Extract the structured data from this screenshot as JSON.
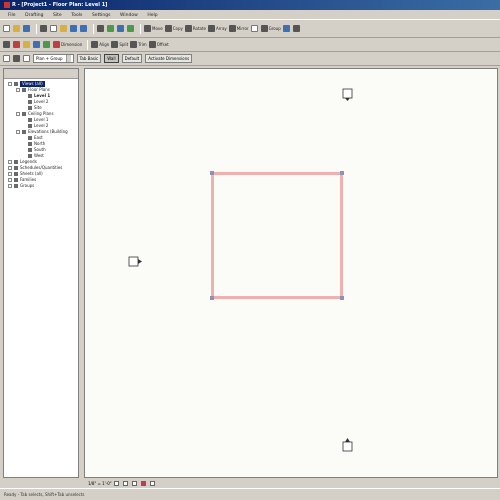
{
  "window": {
    "title": "R - [Project1 - Floor Plan: Level 1]"
  },
  "menu": [
    "File",
    "Drafting",
    "Site",
    "Tools",
    "Settings",
    "Window",
    "Help"
  ],
  "toolbar1": {
    "dimension_label": "Dimension",
    "modify_tools": [
      "Move",
      "Copy",
      "Rotate",
      "Array",
      "Mirror",
      "Group"
    ]
  },
  "toolbar2": {
    "tools": [
      "Align",
      "Split",
      "Trim",
      "Offset"
    ]
  },
  "options_bar": {
    "type_select": "Plan + Group",
    "buttons": [
      "Tab Basic",
      "Wall",
      "Default",
      "Activate Dimensions"
    ]
  },
  "browser": {
    "tree": [
      {
        "label": "Views (all)",
        "level": 0,
        "selected": true
      },
      {
        "label": "Floor Plans",
        "level": 1
      },
      {
        "label": "Level 1",
        "level": 2,
        "bold": true
      },
      {
        "label": "Level 2",
        "level": 2
      },
      {
        "label": "Site",
        "level": 2
      },
      {
        "label": "Ceiling Plans",
        "level": 1
      },
      {
        "label": "Level 1",
        "level": 2
      },
      {
        "label": "Level 2",
        "level": 2
      },
      {
        "label": "Elevations (Building",
        "level": 1
      },
      {
        "label": "East",
        "level": 2
      },
      {
        "label": "North",
        "level": 2
      },
      {
        "label": "South",
        "level": 2
      },
      {
        "label": "West",
        "level": 2
      },
      {
        "label": "Legends",
        "level": 0
      },
      {
        "label": "Schedules/Quantities",
        "level": 0
      },
      {
        "label": "Sheets (all)",
        "level": 0
      },
      {
        "label": "Families",
        "level": 0
      },
      {
        "label": "Groups",
        "level": 0
      }
    ]
  },
  "view_control": {
    "scale": "1/8\" = 1'-0\""
  },
  "status": {
    "text": "Ready - Tab selects, Shift+Tab unselects"
  }
}
